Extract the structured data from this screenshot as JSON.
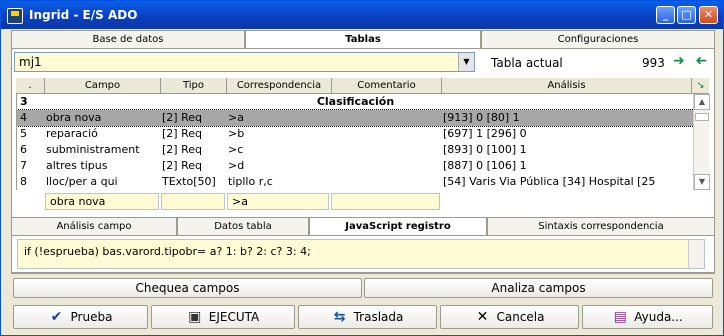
{
  "window": {
    "title": "Ingrid - E/S ADO"
  },
  "tabs_top": [
    "Base de datos",
    "Tablas",
    "Configuraciones"
  ],
  "tabs_top_active": "Tablas",
  "table_select": {
    "value": "mj1"
  },
  "tabla_actual": {
    "label": "Tabla actual",
    "value": "993"
  },
  "grid": {
    "columns": [
      ".",
      "Campo",
      "Tipo",
      "Correspondencia",
      "Comentario",
      "Análisis"
    ],
    "header_row": {
      "num": "3",
      "title": "Clasificación"
    },
    "rows": [
      {
        "num": "4",
        "campo": "obra nova",
        "tipo": "[2] Req",
        "corr": ">a",
        "coment": "",
        "analisis": "[913] 0  [80] 1",
        "selected": true
      },
      {
        "num": "5",
        "campo": "reparació",
        "tipo": "[2] Req",
        "corr": ">b",
        "coment": "",
        "analisis": "[697] 1  [296] 0",
        "selected": false
      },
      {
        "num": "6",
        "campo": "subministrament",
        "tipo": "[2] Req",
        "corr": ">c",
        "coment": "",
        "analisis": "[893] 0  [100] 1",
        "selected": false
      },
      {
        "num": "7",
        "campo": "altres tipus",
        "tipo": "[2] Req",
        "corr": ">d",
        "coment": "",
        "analisis": "[887] 0  [106] 1",
        "selected": false
      },
      {
        "num": "8",
        "campo": "lloc/per a qui",
        "tipo": "TExto[50]",
        "corr": "tipllo r,c",
        "coment": "",
        "analisis": "[54] Varis Via Pública  [34] Hospital  [25",
        "selected": false
      }
    ]
  },
  "edit_fields": {
    "campo": "obra nova",
    "tipo": "",
    "corr": ">a",
    "coment": ""
  },
  "tabs_bottom": [
    "Análisis campo",
    "Datos tabla",
    "JavaScript registro",
    "Sintaxis correspondencia"
  ],
  "tabs_bottom_active": "JavaScript registro",
  "script_text": "if (!esprueba) bas.varord.tipobr= a? 1: b? 2: c? 3: 4;",
  "buttons_mid": {
    "chequea": "Chequea campos",
    "analiza": "Analiza campos"
  },
  "buttons_bottom": [
    {
      "label": "Prueba",
      "icon": "check-icon"
    },
    {
      "label": "EJECUTA",
      "icon": "save-icon"
    },
    {
      "label": "Traslada",
      "icon": "transfer-icon"
    },
    {
      "label": "Cancela",
      "icon": "close-icon"
    },
    {
      "label": "Ayuda...",
      "icon": "help-book-icon"
    }
  ],
  "colors": {
    "title_bar": "#0a4fd6",
    "field_bg": "#fffbd4",
    "selection": "#a7a7a7",
    "nav_arrow": "#1b8a4d"
  }
}
